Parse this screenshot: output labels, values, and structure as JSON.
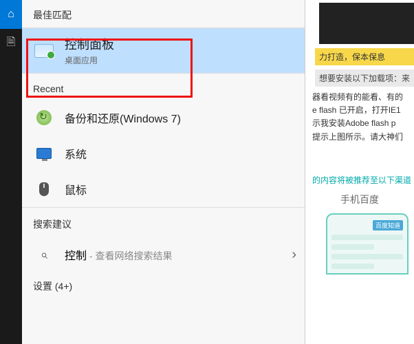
{
  "rail": {
    "home": "⌂",
    "doc": "🗎"
  },
  "sections": {
    "best_match": "最佳匹配",
    "recent": "Recent",
    "suggestions": "搜索建议"
  },
  "best": {
    "title": "控制面板",
    "subtitle": "桌面应用"
  },
  "recent_items": {
    "0": {
      "label": "备份和还原(Windows 7)"
    },
    "1": {
      "label": "系统"
    },
    "2": {
      "label": "鼠标"
    }
  },
  "suggestion": {
    "term": "控制",
    "hint": " - 查看网络搜索结果",
    "chevron": "›"
  },
  "settings_row": "设置 (4+)",
  "right": {
    "yellow": "力打造，保本保息",
    "grey": "想要安装以下加载项：来",
    "l1": "器看视频有的能看、有的",
    "l2": "e flash 已开启，打开IE1",
    "l3": "示我安装Adobe flash p",
    "l4": "提示上图所示。请大神们",
    "teal": "的内容将被推荐至以下渠道",
    "phone_title": "手机百度",
    "pill": "百度知道"
  }
}
